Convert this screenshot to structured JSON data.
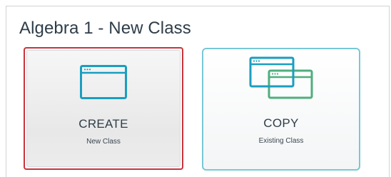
{
  "page": {
    "title": "Algebra 1 - New Class"
  },
  "options": [
    {
      "label": "CREATE",
      "sublabel": "New Class",
      "icon": "single-window-icon"
    },
    {
      "label": "COPY",
      "sublabel": "Existing Class",
      "icon": "duplicate-window-icon"
    }
  ],
  "colors": {
    "primary_icon": "#1a9ec0",
    "secondary_icon": "#4fae7f",
    "selected_border": "#c8343c",
    "card_border": "#78c8d6",
    "text": "#2e3d49"
  }
}
